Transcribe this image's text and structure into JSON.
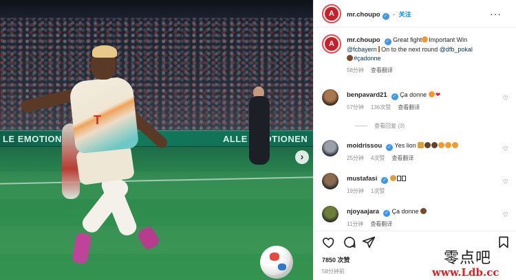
{
  "post": {
    "likes": "7850 次赞",
    "time": "58分钟前"
  },
  "header": {
    "username": "mr.choupo",
    "follow_label": "关注",
    "more_label": "···"
  },
  "caption": {
    "username": "mr.choupo",
    "text_1": "Great fight",
    "text_2": "Important Win",
    "mention_1": "@fcbayern",
    "text_3": "On to the next round",
    "mention_2": "@dfb_pokal",
    "hashtag": "#çadonne",
    "time": "58分钟",
    "translate": "查看翻译"
  },
  "comments": [
    {
      "username": "benpavard21",
      "text": "Ça donne",
      "time": "57分钟",
      "likes": "136次赞",
      "translate": "查看翻译",
      "replies": "查看回复 (3)"
    },
    {
      "username": "moidrissou",
      "text": "Yes lion",
      "time": "25分钟",
      "likes": "4次赞",
      "translate": "查看翻译"
    },
    {
      "username": "mustafasi",
      "text": "",
      "time": "19分钟",
      "likes": "1次赞"
    },
    {
      "username": "njoyaajara",
      "text": "Ça donne",
      "time": "11分钟",
      "translate": "查看翻译"
    }
  ],
  "photo": {
    "ad_left": "LE EMOTION",
    "ad_right": "ALLE EMOTIONEN",
    "nav_arrow": "›"
  },
  "watermark": {
    "cn": "零点吧",
    "url": "www.Ldb.cc"
  },
  "icons": {
    "like": "heart-icon",
    "comment": "comment-icon",
    "share": "share-icon",
    "save": "bookmark-icon"
  },
  "colors": {
    "accent": "#0095f6",
    "verified": "#3897f0",
    "muted": "#8e8e8e"
  }
}
